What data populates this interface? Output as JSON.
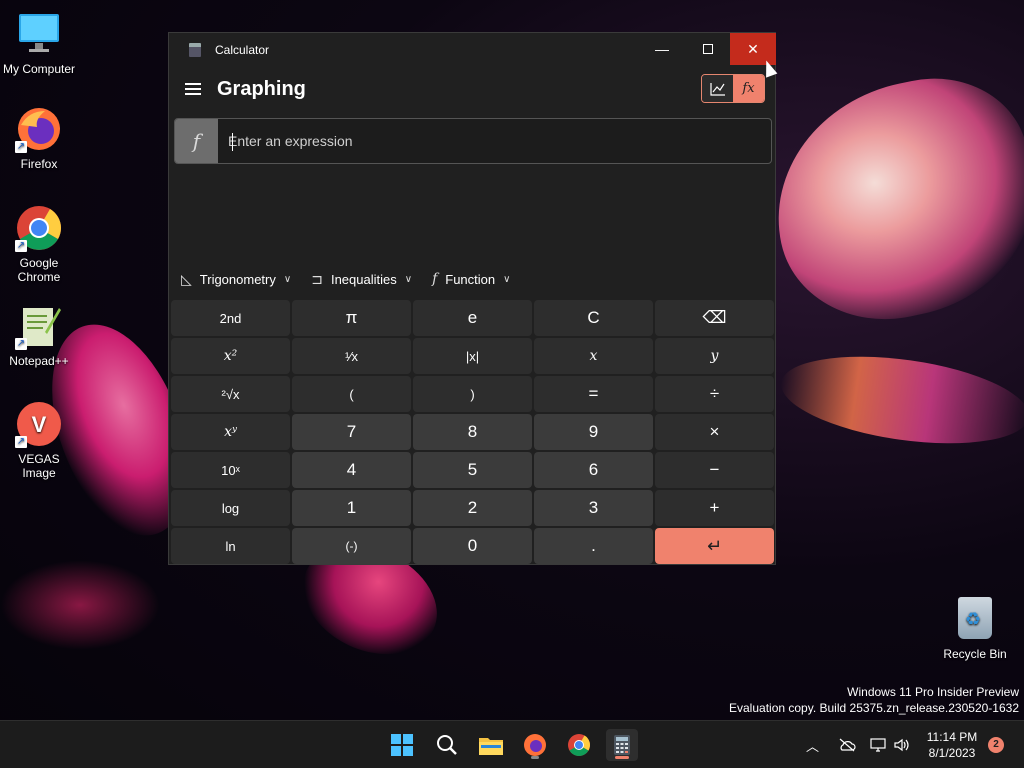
{
  "desktop": {
    "icons": [
      {
        "label": "My Computer"
      },
      {
        "label": "Firefox"
      },
      {
        "label": "Google Chrome"
      },
      {
        "label": "Notepad++"
      },
      {
        "label": "VEGAS Image"
      }
    ],
    "recycle_bin": "Recycle Bin",
    "watermark": {
      "line1": "Windows 11 Pro Insider Preview",
      "line2": "Evaluation copy. Build 25375.zn_release.230520-1632"
    }
  },
  "calculator": {
    "window_title": "Calculator",
    "mode": "Graphing",
    "expression_placeholder": "Enter an expression",
    "expression_glyph": "f",
    "view_func_glyph": "fx",
    "function_bar": [
      {
        "label": "Trigonometry"
      },
      {
        "label": "Inequalities"
      },
      {
        "label": "Function"
      }
    ],
    "keys": [
      [
        "2nd",
        "π",
        "e",
        "C",
        "⌫"
      ],
      [
        "x²",
        "¹⁄x",
        "|x|",
        "x",
        "y"
      ],
      [
        "²√x",
        "(",
        ")",
        "=",
        "÷"
      ],
      [
        "xʸ",
        "7",
        "8",
        "9",
        "×"
      ],
      [
        "10ˣ",
        "4",
        "5",
        "6",
        "−"
      ],
      [
        "log",
        "1",
        "2",
        "3",
        "+"
      ],
      [
        "ln",
        "(-)",
        "0",
        ".",
        "↵"
      ]
    ],
    "accent_color": "#f0826d"
  },
  "taskbar": {
    "time": "11:14 PM",
    "date": "8/1/2023",
    "notification_count": "2"
  }
}
